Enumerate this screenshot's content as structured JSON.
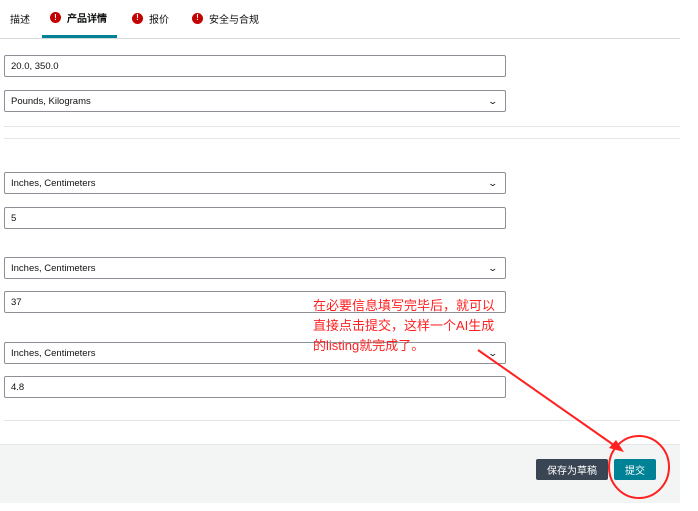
{
  "tabs": [
    {
      "label": "描述",
      "warning": false
    },
    {
      "label": "产品详情",
      "warning": true
    },
    {
      "label": "报价",
      "warning": true
    },
    {
      "label": "安全与合规",
      "warning": true
    }
  ],
  "warning_glyph": "!",
  "fields": {
    "weight_value": "20.0, 350.0",
    "weight_unit": "Pounds, Kilograms",
    "length_unit": "Inches, Centimeters",
    "length_value": "5",
    "width_unit": "Inches, Centimeters",
    "width_value": "37",
    "height_unit": "Inches, Centimeters",
    "height_value": "4.8"
  },
  "footer": {
    "save_draft_label": "保存为草稿",
    "submit_label": "提交"
  },
  "annotation": {
    "lines": [
      "在必要信息填写完毕后，就可以",
      "直接点击提交，这样一个AI生成",
      "的listing就完成了。"
    ],
    "color": "#ff2020"
  },
  "colors": {
    "accent": "#008296",
    "warning": "#c40000",
    "draft_button": "#3a4553"
  },
  "icons": {
    "warning": "exclamation-circle-icon",
    "dropdown": "chevron-down-icon"
  }
}
